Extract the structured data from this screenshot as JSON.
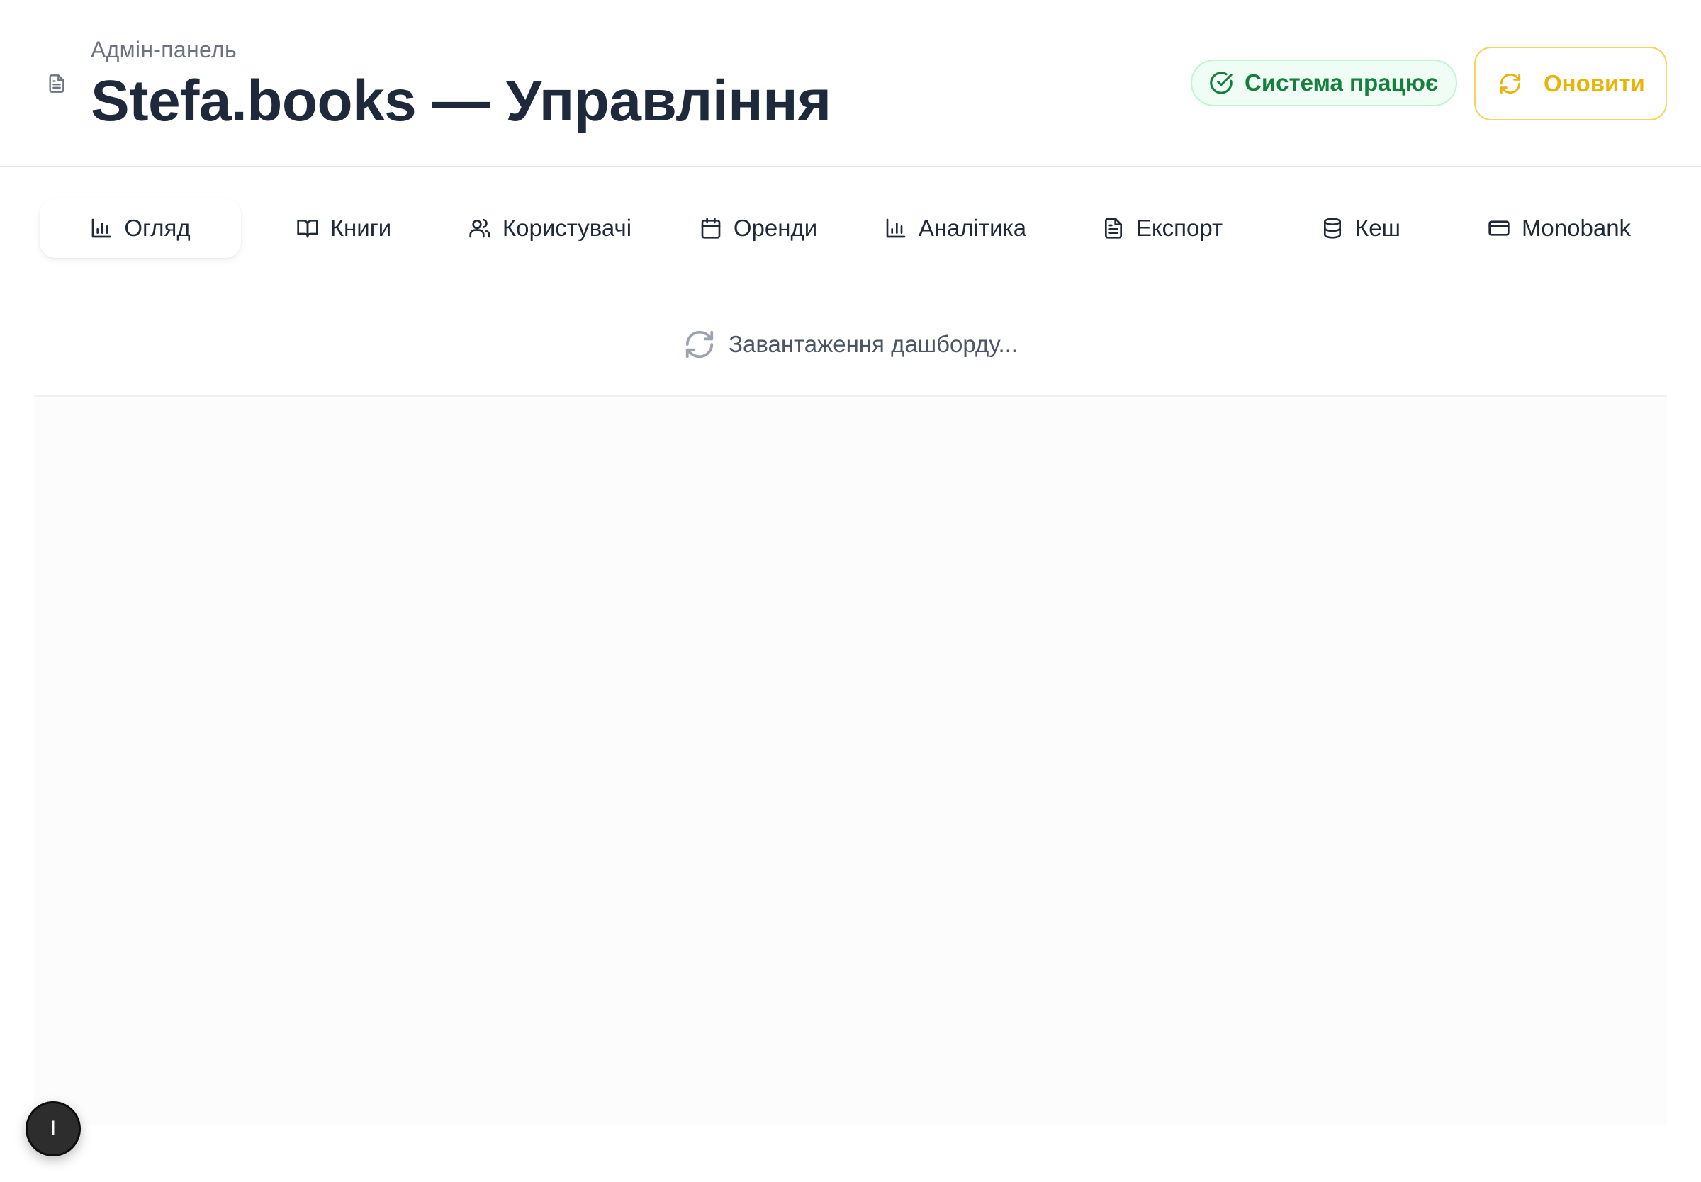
{
  "header": {
    "subtitle": "Адмін-панель",
    "title": "Stefa.books — Управління",
    "icon": "document-icon",
    "status_label": "Система працює",
    "status_icon": "check-circle-icon",
    "refresh_label": "Оновити",
    "refresh_icon": "refresh-icon"
  },
  "tabs": [
    {
      "label": "Огляд",
      "icon": "bar-chart-icon",
      "active": true
    },
    {
      "label": "Книги",
      "icon": "book-open-icon",
      "active": false
    },
    {
      "label": "Користувачі",
      "icon": "users-icon",
      "active": false
    },
    {
      "label": "Оренди",
      "icon": "calendar-icon",
      "active": false
    },
    {
      "label": "Аналітика",
      "icon": "bar-chart-icon",
      "active": false
    },
    {
      "label": "Експорт",
      "icon": "file-text-icon",
      "active": false
    },
    {
      "label": "Кеш",
      "icon": "database-icon",
      "active": false
    },
    {
      "label": "Monobank",
      "icon": "credit-card-icon",
      "active": false
    }
  ],
  "loading": {
    "text": "Завантаження дашборду...",
    "icon": "spinner-icon"
  },
  "floating_button": {
    "label": "I"
  },
  "colors": {
    "status_green": "#15803d",
    "status_bg": "#f0fdf4",
    "accent_yellow": "#eab308",
    "title_dark": "#1e293b"
  }
}
